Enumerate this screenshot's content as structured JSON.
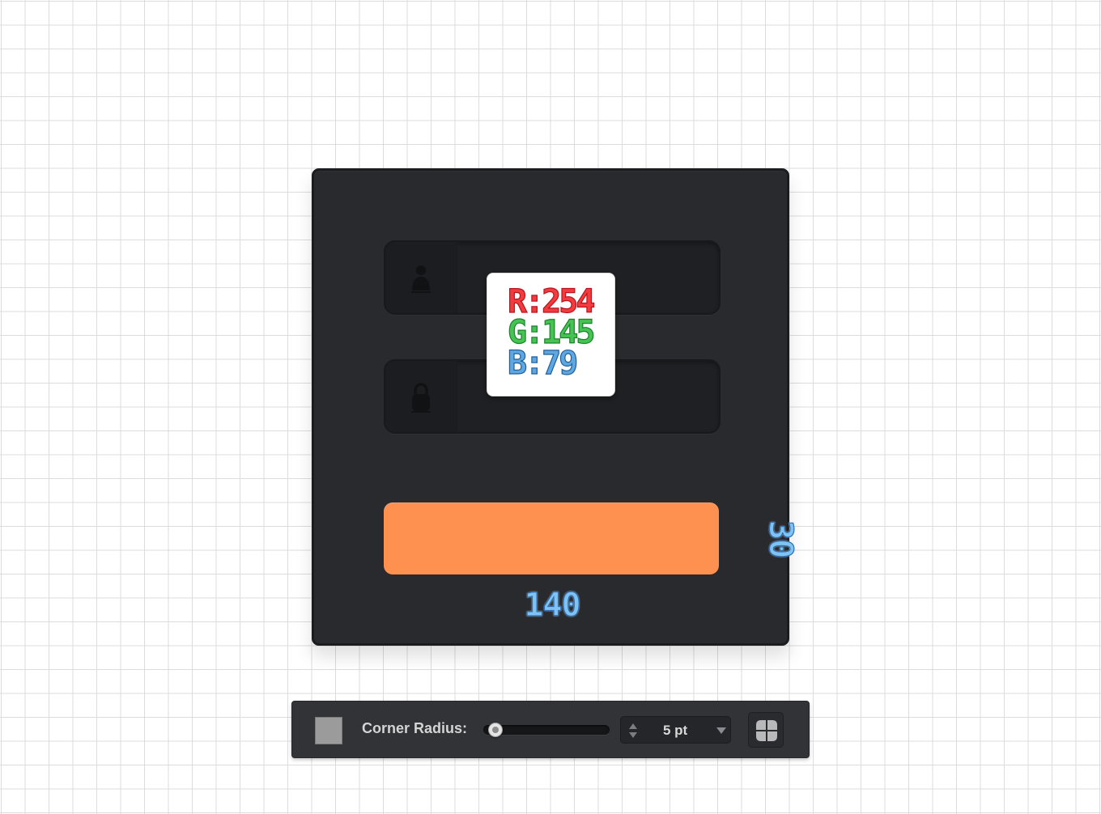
{
  "dimensions": {
    "width": "140",
    "height": "30"
  },
  "color_readout": {
    "r": "R:254",
    "g": "G:145",
    "b": "B:79"
  },
  "button_color": "#fe914f",
  "fields": [
    {
      "icon": "user-icon"
    },
    {
      "icon": "lock-icon"
    }
  ],
  "toolbar": {
    "corner_radius_label": "Corner Radius:",
    "corner_radius_value": "5 pt",
    "swatch_color": "#9b9b9b"
  }
}
